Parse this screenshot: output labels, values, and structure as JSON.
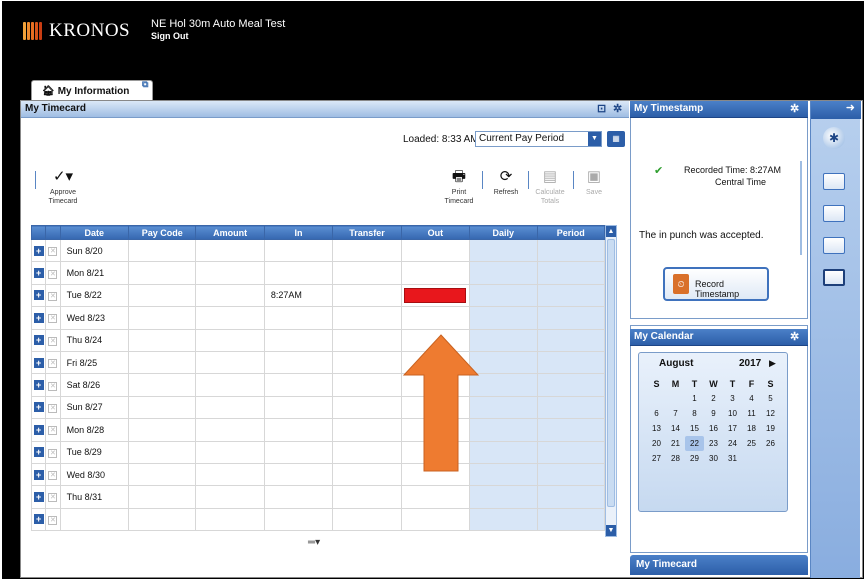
{
  "brand": {
    "logo_text": "KRONOS"
  },
  "header": {
    "user_name": "NE Hol 30m Auto Meal Test",
    "sign_out": "Sign Out"
  },
  "workspace_tab": {
    "label": "My Information"
  },
  "timecard": {
    "title": "My Timecard",
    "loaded": "Loaded: 8:33 AM",
    "period": "Current Pay Period",
    "toolbar": {
      "approve_label": "Approve Timecard",
      "print_label": "Print Timecard",
      "refresh_label": "Refresh",
      "calculate_label": "Calculate Totals",
      "save_label": "Save"
    },
    "columns": [
      "Date",
      "Pay Code",
      "Amount",
      "In",
      "Transfer",
      "Out",
      "Daily",
      "Period"
    ],
    "rows": [
      {
        "date": "Sun 8/20",
        "in": "",
        "out_highlight": false
      },
      {
        "date": "Mon 8/21",
        "in": "",
        "out_highlight": false
      },
      {
        "date": "Tue 8/22",
        "in": "8:27AM",
        "out_highlight": true
      },
      {
        "date": "Wed 8/23",
        "in": "",
        "out_highlight": false
      },
      {
        "date": "Thu 8/24",
        "in": "",
        "out_highlight": false
      },
      {
        "date": "Fri 8/25",
        "in": "",
        "out_highlight": false
      },
      {
        "date": "Sat 8/26",
        "in": "",
        "out_highlight": false
      },
      {
        "date": "Sun 8/27",
        "in": "",
        "out_highlight": false
      },
      {
        "date": "Mon 8/28",
        "in": "",
        "out_highlight": false
      },
      {
        "date": "Tue 8/29",
        "in": "",
        "out_highlight": false
      },
      {
        "date": "Wed 8/30",
        "in": "",
        "out_highlight": false
      },
      {
        "date": "Thu 8/31",
        "in": "",
        "out_highlight": false
      },
      {
        "date": "",
        "in": "",
        "out_highlight": false
      }
    ]
  },
  "timestamp": {
    "title": "My Timestamp",
    "recorded_time": "Recorded Time: 8:27AM",
    "time_zone": "Central Time",
    "message": "The in punch was accepted.",
    "record_button": "Record Timestamp"
  },
  "calendar": {
    "title": "My Calendar",
    "month": "August",
    "year": "2017",
    "weekdays": [
      "S",
      "M",
      "T",
      "W",
      "T",
      "F",
      "S"
    ],
    "weeks": [
      [
        "",
        "",
        "1",
        "2",
        "3",
        "4",
        "5"
      ],
      [
        "6",
        "7",
        "8",
        "9",
        "10",
        "11",
        "12"
      ],
      [
        "13",
        "14",
        "15",
        "16",
        "17",
        "18",
        "19"
      ],
      [
        "20",
        "21",
        "22",
        "23",
        "24",
        "25",
        "26"
      ],
      [
        "27",
        "28",
        "29",
        "30",
        "31",
        "",
        ""
      ]
    ],
    "today": "22"
  },
  "bottom_tab": {
    "label": "My Timecard"
  },
  "colors": {
    "accent": "#2c5ea8",
    "header_bg": "#000000",
    "highlight_red": "#e8171c",
    "arrow_orange": "#ee7b30"
  }
}
